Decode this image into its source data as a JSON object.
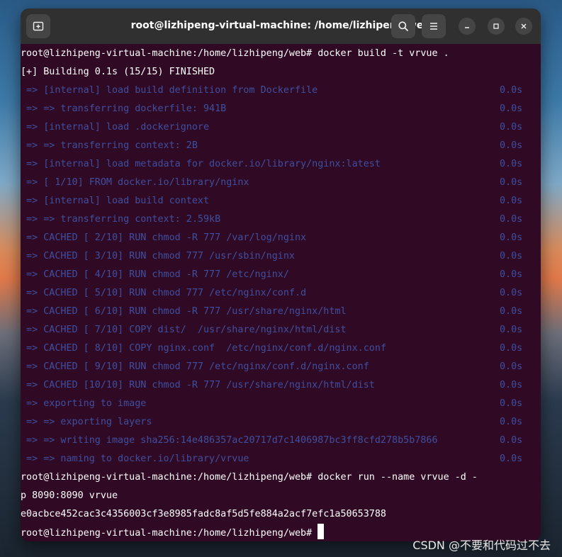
{
  "window": {
    "title": "root@lizhipeng-virtual-machine: /home/lizhipeng/web"
  },
  "icons": {
    "new_tab": "new-tab-icon",
    "search": "search-icon",
    "menu": "hamburger-menu-icon",
    "minimize": "minimize-icon",
    "maximize": "maximize-icon",
    "close": "close-icon"
  },
  "terminal": {
    "colors": {
      "background": "#300a24",
      "text": "#ffffff",
      "dim_text": "#3f4fa0",
      "titlebar": "#303030"
    },
    "prompt_build": "root@lizhipeng-virtual-machine:/home/lizhipeng/web# docker build -t vrvue .",
    "building": "[+] Building 0.1s (15/15) FINISHED",
    "steps": [
      {
        "text": " => [internal] load build definition from Dockerfile",
        "time": "0.0s"
      },
      {
        "text": " => => transferring dockerfile: 941B",
        "time": "0.0s"
      },
      {
        "text": " => [internal] load .dockerignore",
        "time": "0.0s"
      },
      {
        "text": " => => transferring context: 2B",
        "time": "0.0s"
      },
      {
        "text": " => [internal] load metadata for docker.io/library/nginx:latest",
        "time": "0.0s"
      },
      {
        "text": " => [ 1/10] FROM docker.io/library/nginx",
        "time": "0.0s"
      },
      {
        "text": " => [internal] load build context",
        "time": "0.0s"
      },
      {
        "text": " => => transferring context: 2.59kB",
        "time": "0.0s"
      },
      {
        "text": " => CACHED [ 2/10] RUN chmod -R 777 /var/log/nginx",
        "time": "0.0s"
      },
      {
        "text": " => CACHED [ 3/10] RUN chmod 777 /usr/sbin/nginx",
        "time": "0.0s"
      },
      {
        "text": " => CACHED [ 4/10] RUN chmod -R 777 /etc/nginx/",
        "time": "0.0s"
      },
      {
        "text": " => CACHED [ 5/10] RUN chmod 777 /etc/nginx/conf.d",
        "time": "0.0s"
      },
      {
        "text": " => CACHED [ 6/10] RUN chmod -R 777 /usr/share/nginx/html",
        "time": "0.0s"
      },
      {
        "text": " => CACHED [ 7/10] COPY dist/  /usr/share/nginx/html/dist",
        "time": "0.0s"
      },
      {
        "text": " => CACHED [ 8/10] COPY nginx.conf  /etc/nginx/conf.d/nginx.conf",
        "time": "0.0s"
      },
      {
        "text": " => CACHED [ 9/10] RUN chmod 777 /etc/nginx/conf.d/nginx.conf",
        "time": "0.0s"
      },
      {
        "text": " => CACHED [10/10] RUN chmod -R 777 /usr/share/nginx/html/dist",
        "time": "0.0s"
      },
      {
        "text": " => exporting to image",
        "time": "0.0s"
      },
      {
        "text": " => => exporting layers",
        "time": "0.0s"
      },
      {
        "text": " => => writing image sha256:14e486357ac20717d7c1406987bc3ff8cfd278b5b7866",
        "time": "0.0s"
      },
      {
        "text": " => => naming to docker.io/library/vrvue",
        "time": "0.0s"
      }
    ],
    "prompt_run_line1": "root@lizhipeng-virtual-machine:/home/lizhipeng/web# docker run --name vrvue -d -",
    "prompt_run_line2": "p 8090:8090 vrvue",
    "container_id": "e0acbce452cac3c4356003cf3e8985fadc8af5d5fe884a2acf7efc1a50653788",
    "prompt_final": "root@lizhipeng-virtual-machine:/home/lizhipeng/web# "
  },
  "watermark": "CSDN @不要和代码过不去"
}
